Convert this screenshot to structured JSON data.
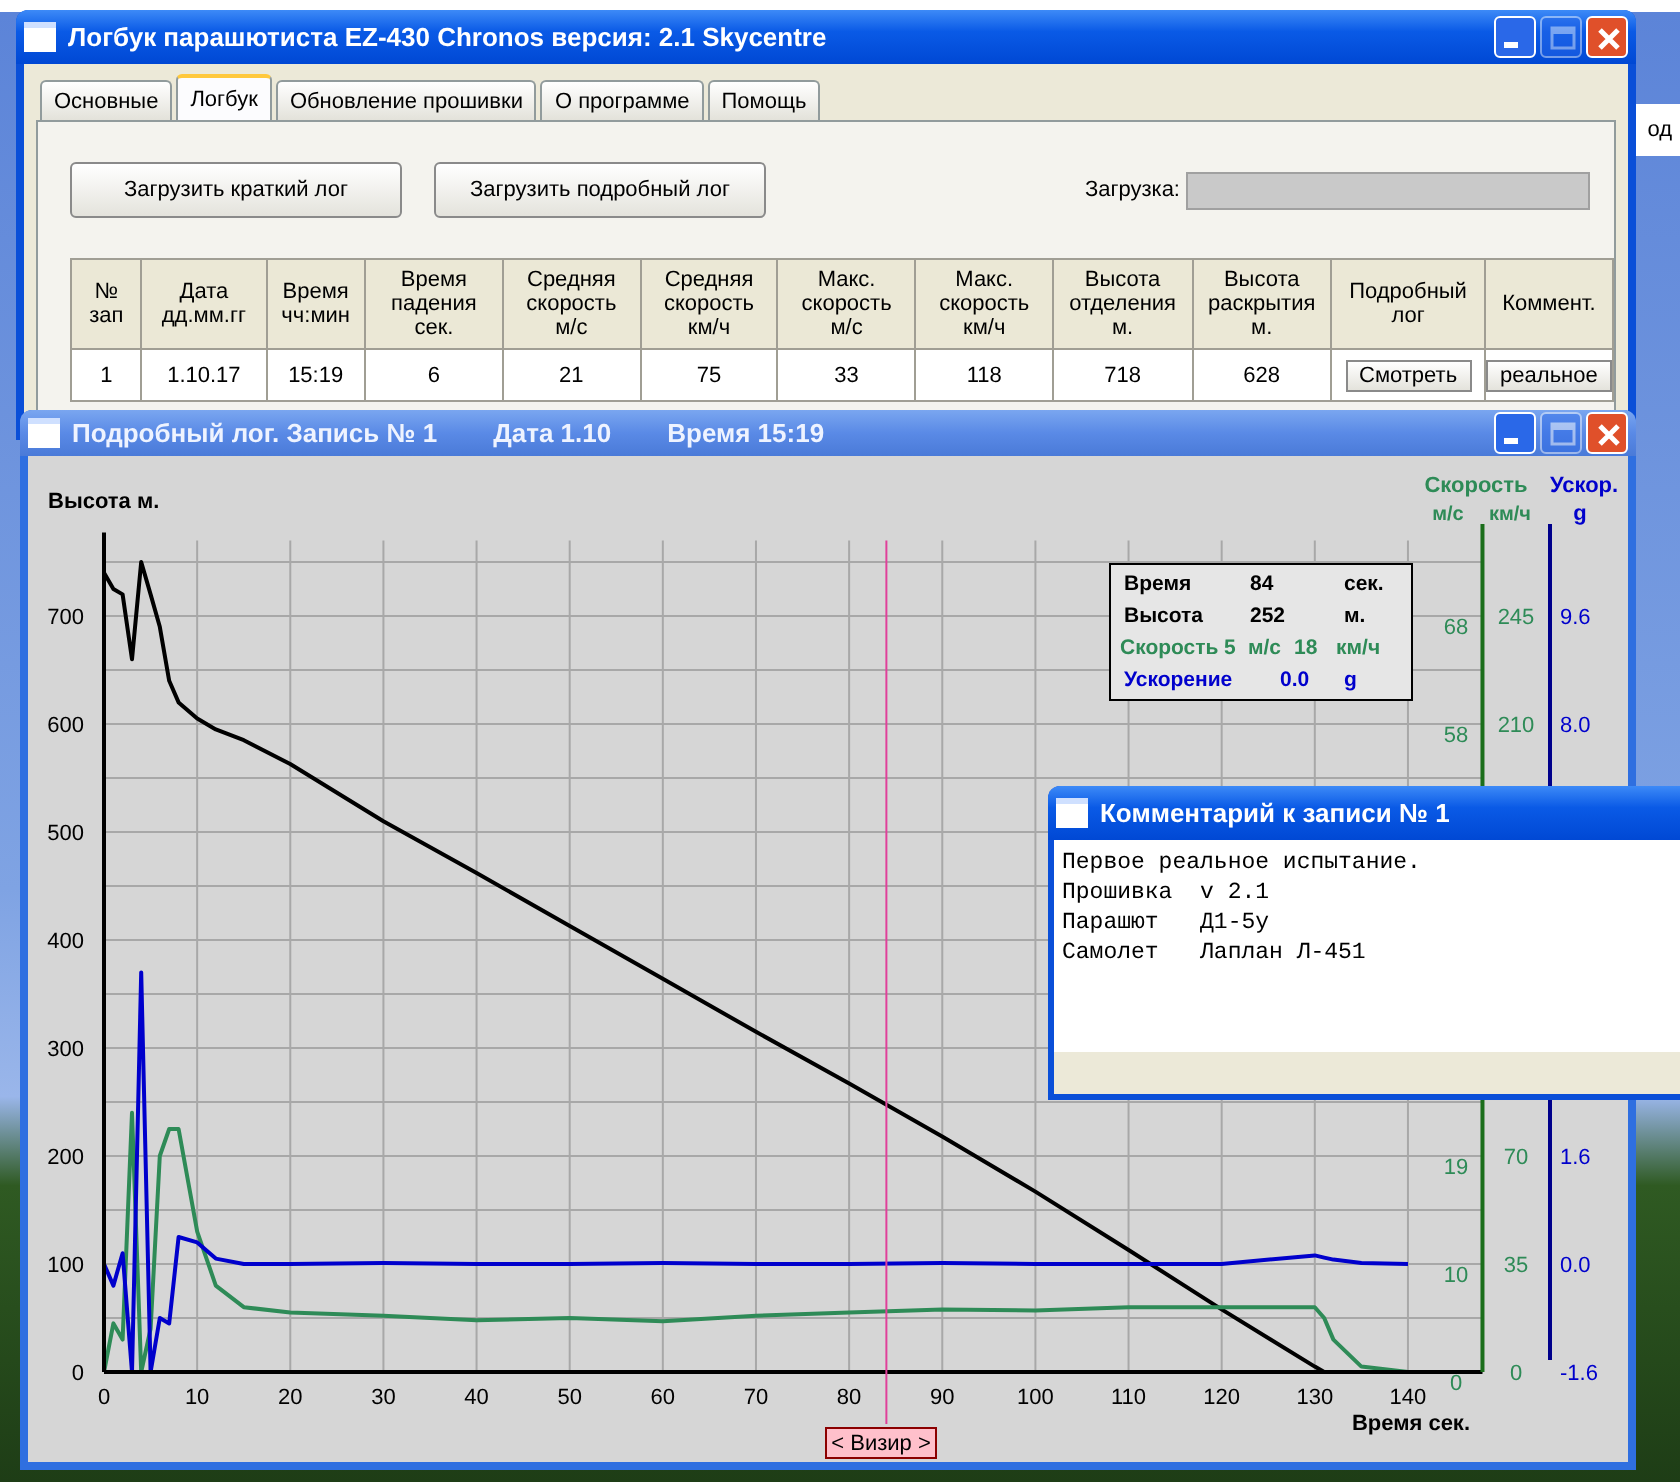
{
  "main_window": {
    "title": "Логбук парашютиста EZ-430 Chronos версия: 2.1 Skycentre",
    "controls": [
      {
        "kind": "minimize",
        "disabled": false
      },
      {
        "kind": "maximize",
        "disabled": true
      },
      {
        "kind": "close",
        "disabled": false
      }
    ]
  },
  "tabs": [
    {
      "label": "Основные",
      "selected": false
    },
    {
      "label": "Логбук",
      "selected": true
    },
    {
      "label": "Обновление прошивки",
      "selected": false
    },
    {
      "label": "О программе",
      "selected": false
    },
    {
      "label": "Помощь",
      "selected": false
    }
  ],
  "buttons": [
    "Загрузить краткий лог",
    "Загрузить подробный лог"
  ],
  "load_progress": {
    "label": "Загрузка:",
    "level": 0
  },
  "table": {
    "columns": [
      "№\nзап",
      "Дата\nдд.мм.гг",
      "Время\nчч:мин",
      "Время\nпадения\nсек.",
      "Средняя\nскорость\nм/с",
      "Средняя\nскорость\nкм/ч",
      "Макс.\nскорость\nм/с",
      "Макс.\nскорость\nкм/ч",
      "Высота\nотделения\nм.",
      "Высота\nраскрытия\nм.",
      "Подробный\nлог",
      "Коммент."
    ],
    "rows": [
      {
        "cells": [
          "1",
          "1.10.17",
          "15:19",
          "6",
          "21",
          "75",
          "33",
          "118",
          "718",
          "628"
        ],
        "log_button": "Смотреть",
        "comment_button": "реальное"
      }
    ]
  },
  "background_fragment": "од",
  "log_window": {
    "title_parts": [
      "Подробный лог. Запись № 1",
      "Дата  1.10",
      "Время 15:19"
    ],
    "controls": [
      {
        "kind": "minimize",
        "disabled": false
      },
      {
        "kind": "maximize",
        "disabled": true
      },
      {
        "kind": "close",
        "disabled": false
      }
    ]
  },
  "chart": {
    "chart_data": {
      "type": "line",
      "xlabel": "Время сек.",
      "ylabel": "Высота м.",
      "x": [
        0,
        1,
        2,
        3,
        4,
        5,
        6,
        7,
        8,
        10,
        12,
        15,
        20,
        30,
        40,
        50,
        60,
        70,
        80,
        90,
        100,
        110,
        120,
        130,
        131,
        132,
        135,
        140
      ],
      "series": [
        {
          "name": "Высота",
          "color": "#000000",
          "values": [
            740,
            725,
            720,
            660,
            750,
            720,
            690,
            640,
            620,
            605,
            595,
            585,
            563,
            510,
            462,
            413,
            364,
            315,
            267,
            218,
            167,
            113,
            58,
            5,
            0,
            0,
            0,
            0
          ]
        },
        {
          "name": "Скорость",
          "color": "#2e8b57",
          "values": [
            0,
            45,
            30,
            240,
            0,
            40,
            200,
            225,
            225,
            130,
            80,
            60,
            55,
            52,
            48,
            50,
            47,
            52,
            55,
            58,
            57,
            60,
            60,
            60,
            50,
            30,
            5,
            0
          ]
        },
        {
          "name": "Ускорение",
          "color": "#0000cc",
          "values": [
            100,
            80,
            110,
            0,
            370,
            0,
            50,
            45,
            125,
            120,
            105,
            100,
            100,
            101,
            100,
            100,
            101,
            100,
            100,
            101,
            100,
            100,
            100,
            108,
            106,
            104,
            101,
            100
          ]
        }
      ],
      "xlim": [
        0,
        148
      ],
      "ylim": [
        0,
        770
      ],
      "grid": true,
      "xticks": [
        0,
        10,
        20,
        30,
        40,
        50,
        60,
        70,
        80,
        90,
        100,
        110,
        120,
        130,
        140
      ],
      "yticks": [
        0,
        100,
        200,
        300,
        400,
        500,
        600,
        700
      ],
      "ref_lines": [
        {
          "axis": "x",
          "value": 84,
          "color": "#e0409a"
        }
      ]
    },
    "speed_axis": {
      "title": "Скорость",
      "units": [
        "м/с",
        "км/ч"
      ],
      "ms_ticks": [
        "68",
        "58",
        "19",
        "10",
        "0"
      ],
      "kmh_ticks": [
        "245",
        "210",
        "70",
        "35",
        "0"
      ]
    },
    "accel_axis": {
      "title": "Ускор.",
      "unit": "g",
      "ticks": [
        "9.6",
        "8.0",
        "1.6",
        "0.0",
        "-1.6"
      ]
    },
    "readout": [
      {
        "kind": "text",
        "cells": [
          "Время",
          "84",
          "сек."
        ]
      },
      {
        "kind": "series",
        "cells": [
          "252",
          "м."
        ]
      },
      {
        "kind": "series",
        "cells": [
          "5",
          "м/с",
          "18",
          "км/ч"
        ]
      },
      {
        "kind": "series",
        "cells": [
          "0.0",
          "g"
        ]
      }
    ],
    "cursor_button": "< Визир >"
  },
  "comment_window": {
    "title": "Комментарий к записи № 1",
    "lines": [
      "Первое реальное испытание.",
      "Прошивка  v 2.1",
      "Парашют   Д1-5у",
      "Самолет   Лаплан Л-451"
    ]
  }
}
